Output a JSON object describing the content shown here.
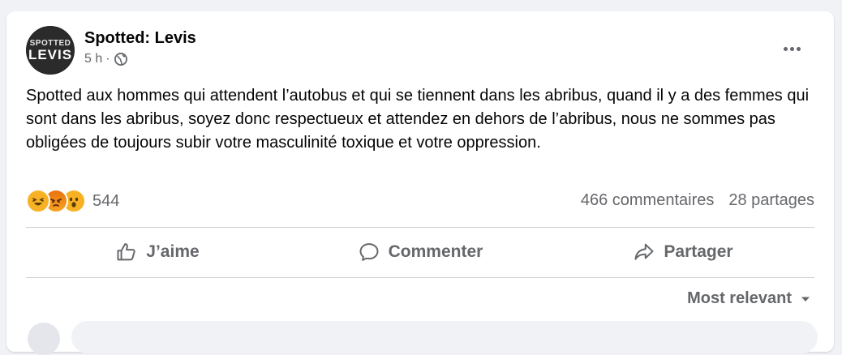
{
  "post": {
    "page_name": "Spotted: Levis",
    "time": "5 h",
    "separator": "·",
    "avatar": {
      "line1": "SPOTTED",
      "line2": "LEVIS"
    },
    "text": "Spotted aux hommes qui attendent l’autobus et qui se tiennent dans les abribus, quand il y a des femmes qui sont dans les abribus, soyez donc respectueux et attendez en dehors de l’abribus, nous ne sommes pas obligées de toujours subir votre masculinité toxique et votre oppression."
  },
  "reactions": {
    "icons": [
      "haha-emoji-icon",
      "angry-emoji-icon",
      "wow-emoji-icon"
    ],
    "count": "544"
  },
  "stats": {
    "comments": "466 commentaires",
    "shares": "28 partages"
  },
  "actions": {
    "like": "J’aime",
    "comment": "Commenter",
    "share": "Partager"
  },
  "comments_sort": {
    "label": "Most relevant"
  },
  "colors": {
    "background": "#f0f2f5",
    "card": "#ffffff",
    "secondary_text": "#65676b",
    "primary_text": "#050505"
  }
}
